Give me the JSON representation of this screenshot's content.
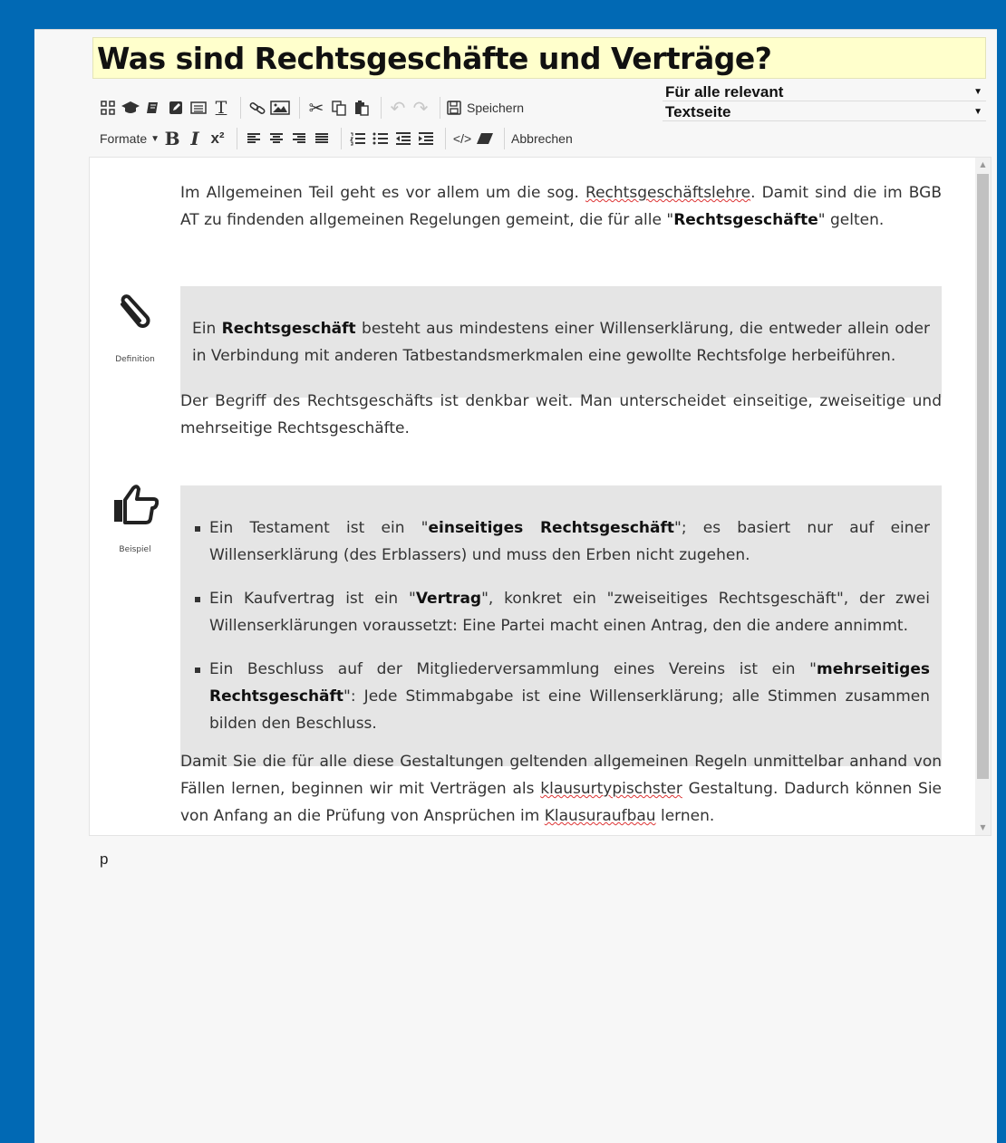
{
  "page": {
    "title": "Was sind Rechtsgeschäfte und Verträge?"
  },
  "toolbar": {
    "save_label": "Speichern",
    "formats_label": "Formate",
    "cancel_label": "Abbrechen",
    "bold_glyph": "B",
    "italic_glyph": "I",
    "superscript_glyph": "x²",
    "code_glyph": "</>",
    "text_glyph": "T"
  },
  "selects": {
    "audience": "Für alle relevant",
    "pagetype": "Textseite"
  },
  "content": {
    "p1": {
      "t1": "Im Allgemeinen Teil geht es vor allem um die sog. ",
      "link": "Rechtsgeschäftslehre",
      "t2": ". Damit sind die im BGB AT zu findenden allgemeinen Regelungen gemeint, die für alle \"",
      "bold": "Rechtsgeschäfte",
      "t3": "\" gelten."
    },
    "definition": {
      "label": "Definition",
      "t1": "Ein ",
      "bold": "Rechtsgeschäft",
      "t2": " besteht aus mindestens einer Willenserklärung, die entweder allein oder in Verbindung mit anderen Tatbestandsmerkmalen eine gewollte Rechtsfolge herbeiführen."
    },
    "p2": "Der Begriff des Rechtsgeschäfts ist denkbar weit. Man unterscheidet einseitige, zweiseitige und mehrseitige Rechtsgeschäfte.",
    "example": {
      "label": "Beispiel",
      "items": [
        {
          "t1": "Ein Testament ist ein \"",
          "bold": "einseitiges Rechtsgeschäft",
          "t2": "\"; es basiert nur auf einer Willenserklärung (des Erblassers) und muss den Erben nicht zugehen."
        },
        {
          "t1": "Ein Kaufvertrag ist ein \"",
          "bold": "Vertrag",
          "t2": "\", konkret ein \"zweiseitiges Rechtsgeschäft\", der zwei Willenserklärungen voraussetzt: Eine Partei macht einen Antrag, den die andere annimmt."
        },
        {
          "t1": "Ein Beschluss auf der Mitgliederversammlung eines Vereins ist ein \"",
          "bold": "mehrseitiges Rechtsgeschäft",
          "t2": "\": Jede Stimmabgabe ist eine Willenserklärung; alle Stimmen zusammen bilden den Beschluss."
        }
      ]
    },
    "p3": {
      "t1": "Damit Sie die für alle diese Gestaltungen geltenden allgemeinen Regeln unmittelbar anhand von Fällen lernen, beginnen wir mit Verträgen als ",
      "s1": "klausurtypischster",
      "t2": " Gestaltung. Dadurch können Sie von Anfang an die Prüfung von Ansprüchen im ",
      "s2": "Klausuraufbau",
      "t3": " lernen."
    }
  },
  "statusbar": {
    "path": "p"
  },
  "colors": {
    "frame": "#0169b4",
    "title_bg": "#ffffcc",
    "box_bg": "#e5e5e5"
  }
}
